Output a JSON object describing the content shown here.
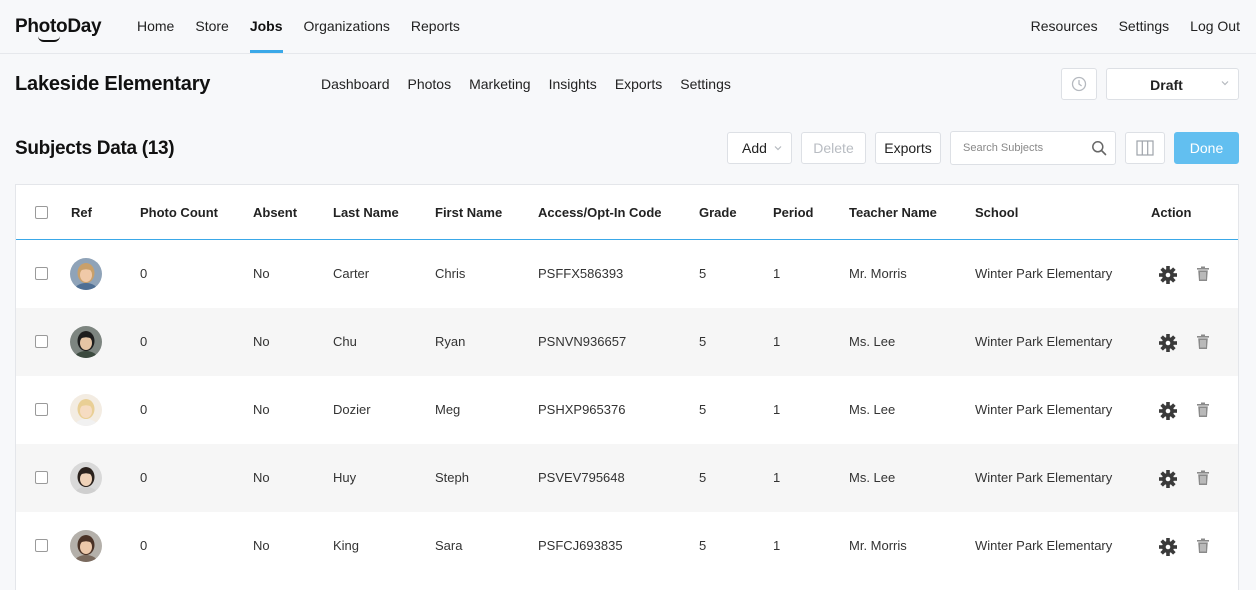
{
  "brand": {
    "logo_text": "PhotoDay"
  },
  "topnav": {
    "left": [
      {
        "label": "Home",
        "active": false
      },
      {
        "label": "Store",
        "active": false
      },
      {
        "label": "Jobs",
        "active": true
      },
      {
        "label": "Organizations",
        "active": false
      },
      {
        "label": "Reports",
        "active": false
      }
    ],
    "right": [
      {
        "label": "Resources"
      },
      {
        "label": "Settings"
      },
      {
        "label": "Log Out"
      }
    ]
  },
  "job": {
    "title": "Lakeside Elementary",
    "subnav": [
      "Dashboard",
      "Photos",
      "Marketing",
      "Insights",
      "Exports",
      "Settings"
    ],
    "status": "Draft"
  },
  "section": {
    "title": "Subjects Data (13)",
    "add_label": "Add",
    "delete_label": "Delete",
    "exports_label": "Exports",
    "search_placeholder": "Search Subjects",
    "done_label": "Done"
  },
  "table": {
    "headers": [
      "Ref",
      "Photo Count",
      "Absent",
      "Last Name",
      "First Name",
      "Access/Opt-In Code",
      "Grade",
      "Period",
      "Teacher Name",
      "School",
      "Action"
    ],
    "rows": [
      {
        "photo_count": "0",
        "absent": "No",
        "last_name": "Carter",
        "first_name": "Chris",
        "code": "PSFFX586393",
        "grade": "5",
        "period": "1",
        "teacher": "Mr. Morris",
        "school": "Winter Park Elementary",
        "avatar": {
          "bg": "#8fa3b8",
          "hair": "#c9a06a",
          "skin": "#f0c9a8",
          "shirt": "#4f6f94"
        }
      },
      {
        "photo_count": "0",
        "absent": "No",
        "last_name": "Chu",
        "first_name": "Ryan",
        "code": "PSNVN936657",
        "grade": "5",
        "period": "1",
        "teacher": "Ms. Lee",
        "school": "Winter Park Elementary",
        "avatar": {
          "bg": "#7d8580",
          "hair": "#1d1d1d",
          "skin": "#e5c4a4",
          "shirt": "#3c4a3f"
        }
      },
      {
        "photo_count": "0",
        "absent": "No",
        "last_name": "Dozier",
        "first_name": "Meg",
        "code": "PSHXP965376",
        "grade": "5",
        "period": "1",
        "teacher": "Ms. Lee",
        "school": "Winter Park Elementary",
        "avatar": {
          "bg": "#f3ece2",
          "hair": "#e9cf95",
          "skin": "#f6dcc2",
          "shirt": "#f1f1f1"
        }
      },
      {
        "photo_count": "0",
        "absent": "No",
        "last_name": "Huy",
        "first_name": "Steph",
        "code": "PSVEV795648",
        "grade": "5",
        "period": "1",
        "teacher": "Ms. Lee",
        "school": "Winter Park Elementary",
        "avatar": {
          "bg": "#d9d9d9",
          "hair": "#2a211c",
          "skin": "#efd2b8",
          "shirt": "#cfcfcf"
        }
      },
      {
        "photo_count": "0",
        "absent": "No",
        "last_name": "King",
        "first_name": "Sara",
        "code": "PSFCJ693835",
        "grade": "5",
        "period": "1",
        "teacher": "Mr. Morris",
        "school": "Winter Park Elementary",
        "avatar": {
          "bg": "#b4b0aa",
          "hair": "#4a3226",
          "skin": "#ecc8aa",
          "shirt": "#7a6a5e"
        }
      }
    ]
  },
  "icons": {
    "settings": "gear-icon",
    "delete": "trash-icon",
    "search": "search-icon",
    "history": "clock-icon",
    "columns": "columns-icon",
    "dropdown": "chevron-down-icon"
  },
  "colors": {
    "accent": "#3aa8e8",
    "done_button": "#62bff0",
    "row_alt": "#f6f6f6",
    "page_bg": "#f7f8fa"
  }
}
